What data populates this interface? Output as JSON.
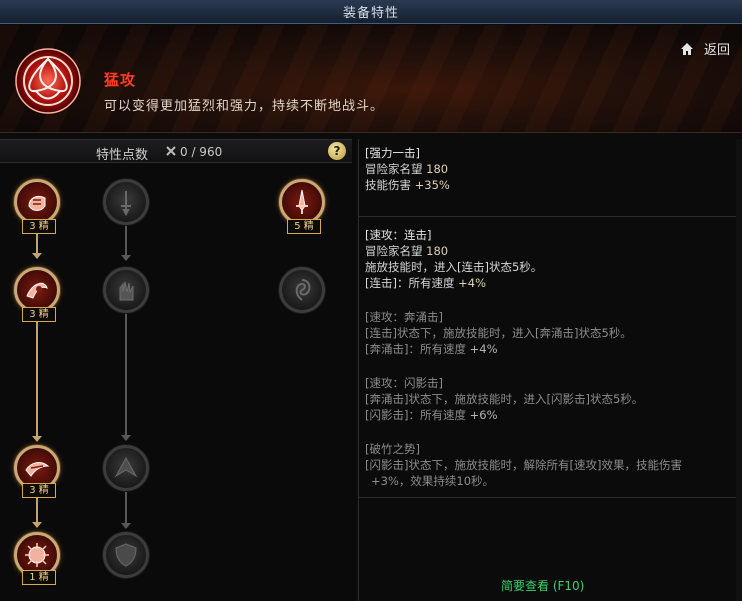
{
  "window": {
    "title": "装备特性"
  },
  "banner": {
    "name": "猛攻",
    "description": "可以变得更加猛烈和强力，持续不断地战斗。",
    "back_label": "返回",
    "accent": "#ff3b2a"
  },
  "points": {
    "label": "特性点数",
    "value": "0 / 960"
  },
  "help": {
    "label": "?"
  },
  "tree": {
    "nodes": [
      {
        "id": "n1",
        "level_label": "3 精",
        "state": "active",
        "icon": "fist-icon"
      },
      {
        "id": "n2",
        "level_label": "3 精",
        "state": "active",
        "icon": "claw-icon"
      },
      {
        "id": "n3",
        "level_label": "3 精",
        "state": "active",
        "icon": "dash-icon"
      },
      {
        "id": "n4",
        "level_label": "1 精",
        "state": "active",
        "icon": "burst-icon"
      },
      {
        "id": "n5",
        "level_label": "",
        "state": "inactive",
        "icon": "sword-icon"
      },
      {
        "id": "n6",
        "level_label": "",
        "state": "inactive",
        "icon": "hand-icon"
      },
      {
        "id": "n7",
        "level_label": "",
        "state": "inactive",
        "icon": "wing-icon"
      },
      {
        "id": "n8",
        "level_label": "",
        "state": "inactive",
        "icon": "shield-icon"
      },
      {
        "id": "n9",
        "level_label": "5 精",
        "state": "active",
        "icon": "blade-icon"
      },
      {
        "id": "n10",
        "level_label": "",
        "state": "inactive",
        "icon": "spin-icon"
      }
    ]
  },
  "details": [
    {
      "title": "[强力一击]",
      "lines": [
        {
          "label": "冒险家名望",
          "value": "180"
        },
        {
          "label": "技能伤害",
          "value": "+35%"
        }
      ]
    },
    {
      "title": "[速攻：连击]",
      "lines": [
        {
          "label": "冒险家名望",
          "value": "180"
        },
        {
          "label": "施放技能时，进入[连击]状态5秒。",
          "value": ""
        },
        {
          "label": "[连击]：所有速度",
          "value": "+4%"
        }
      ]
    },
    {
      "title": "[速攻：奔涌击]",
      "lines": [
        {
          "label": "[连击]状态下，施放技能时，进入[奔涌击]状态5秒。",
          "value": ""
        },
        {
          "label": "[奔涌击]：所有速度",
          "value": "+4%"
        }
      ]
    },
    {
      "title": "[速攻：闪影击]",
      "lines": [
        {
          "label": "[奔涌击]状态下，施放技能时，进入[闪影击]状态5秒。",
          "value": ""
        },
        {
          "label": "[闪影击]：所有速度",
          "value": "+6%"
        }
      ]
    },
    {
      "title": "[破竹之势]",
      "lines": [
        {
          "label": "[闪影击]状态下，施放技能时，解除所有[速攻]效果，技能伤害",
          "value": ""
        },
        {
          "label": "+3%，效果持续10秒。",
          "value": ""
        }
      ]
    }
  ],
  "summary_button": "简要查看 (F10)",
  "colors": {
    "gold": "#c4a46a",
    "green": "#3bd06a",
    "dark": "#0b0b0c"
  }
}
